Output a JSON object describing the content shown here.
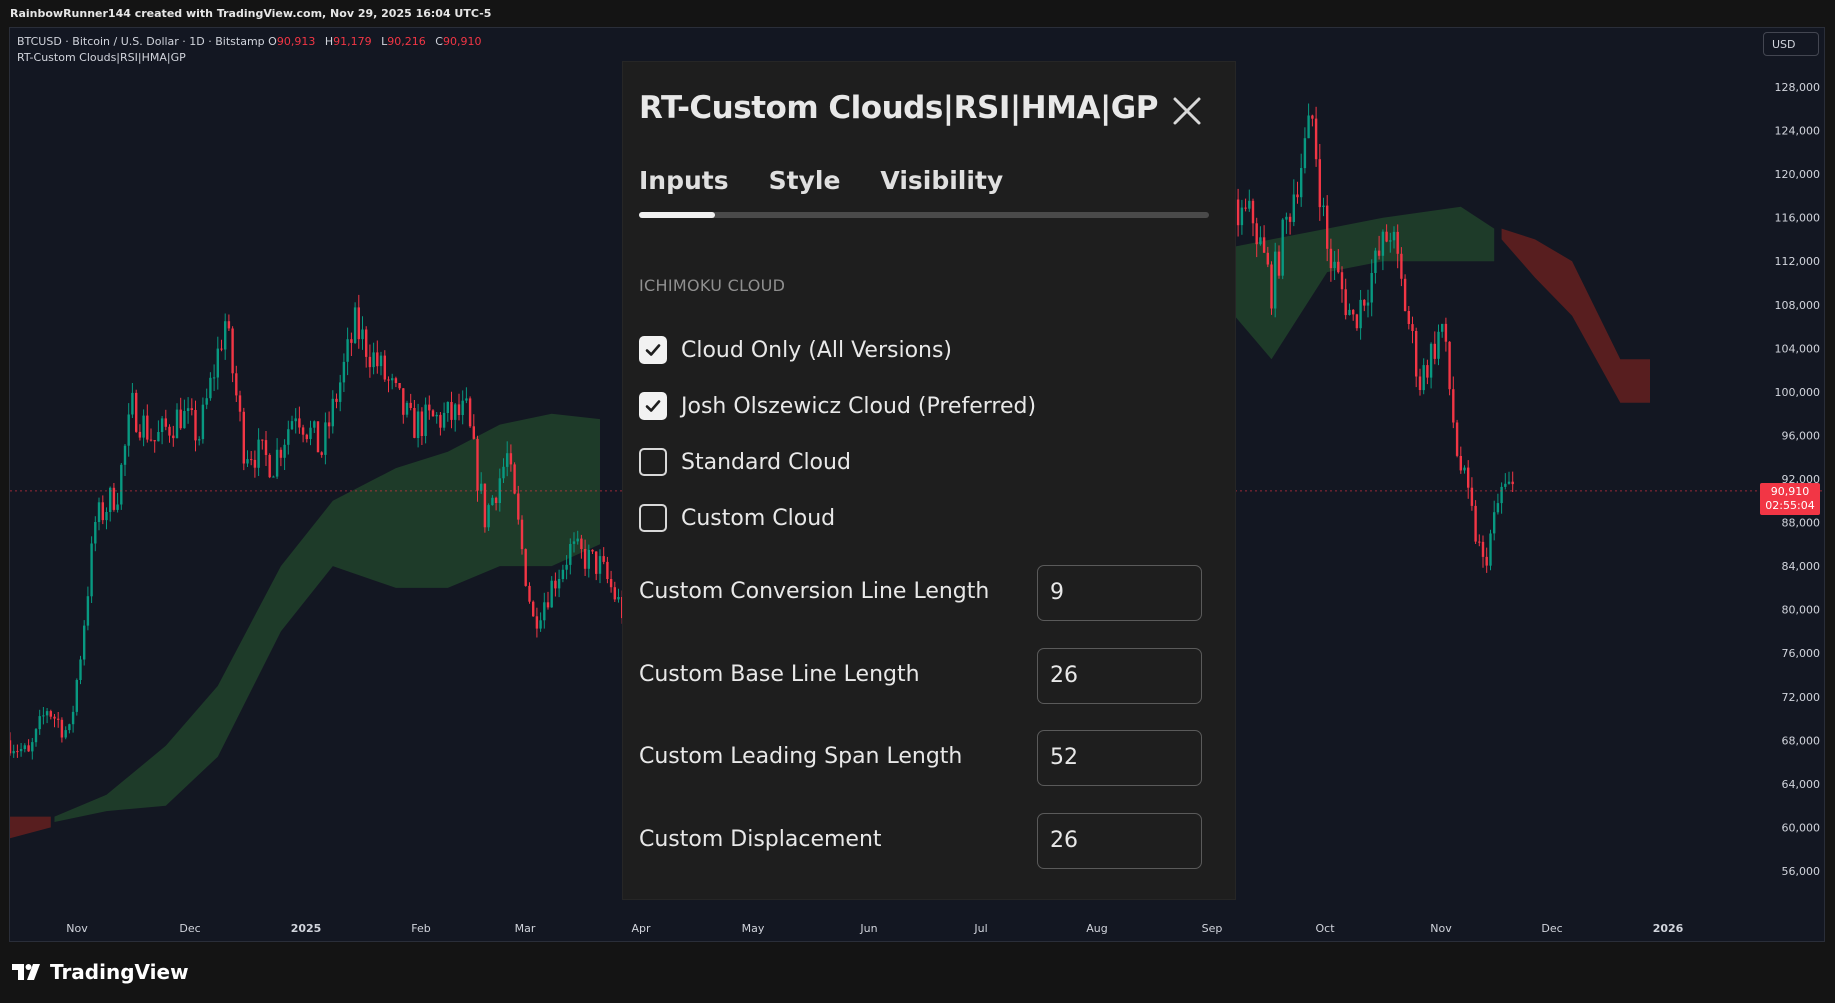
{
  "header": {
    "credit": "RainbowRunner144 created with TradingView.com, Nov 29, 2025 16:04 UTC-5"
  },
  "chart": {
    "symbol": "BTCUSD · Bitcoin / U.S. Dollar · 1D · Bitstamp",
    "open_label": "O",
    "open": "90,913",
    "high_label": "H",
    "high": "91,179",
    "low_label": "L",
    "low": "90,216",
    "close_label": "C",
    "close": "90,910",
    "indicator": "RT-Custom Clouds|RSI|HMA|GP",
    "currency": "USD",
    "last_price": "90,910",
    "countdown": "02:55:04"
  },
  "footer": {
    "brand": "TradingView"
  },
  "dialog": {
    "title": "RT-Custom Clouds|RSI|HMA|GP",
    "tabs": [
      "Inputs",
      "Style",
      "Visibility"
    ],
    "active_tab": "Inputs",
    "section": "ICHIMOKU CLOUD",
    "checkboxes": [
      {
        "label": "Cloud Only (All Versions)",
        "checked": true
      },
      {
        "label": "Josh Olszewicz Cloud (Preferred)",
        "checked": true
      },
      {
        "label": "Standard Cloud",
        "checked": false
      },
      {
        "label": "Custom Cloud",
        "checked": false
      }
    ],
    "fields": [
      {
        "label": "Custom Conversion Line Length",
        "value": "9"
      },
      {
        "label": "Custom Base Line Length",
        "value": "26"
      },
      {
        "label": "Custom Leading Span Length",
        "value": "52"
      },
      {
        "label": "Custom Displacement",
        "value": "26"
      }
    ]
  },
  "chart_data": {
    "type": "candlestick",
    "title": "BTCUSD · Bitcoin / U.S. Dollar · 1D · Bitstamp",
    "x_tick_labels": [
      "Nov",
      "Dec",
      "2025",
      "Feb",
      "Mar",
      "Apr",
      "May",
      "Jun",
      "Jul",
      "Aug",
      "Sep",
      "Oct",
      "Nov",
      "Dec",
      "2026"
    ],
    "y_tick_labels": [
      "128,000",
      "124,000",
      "120,000",
      "116,000",
      "112,000",
      "108,000",
      "104,000",
      "100,000",
      "96,000",
      "92,000",
      "88,000",
      "84,000",
      "80,000",
      "76,000",
      "72,000",
      "68,000",
      "64,000",
      "60,000",
      "56,000"
    ],
    "ylim": [
      54000,
      130000
    ],
    "price_path": [
      [
        "2024-10-20",
        68000
      ],
      [
        "2024-10-25",
        66500
      ],
      [
        "2024-10-30",
        71000
      ],
      [
        "2024-11-05",
        68500
      ],
      [
        "2024-11-08",
        76000
      ],
      [
        "2024-11-12",
        88000
      ],
      [
        "2024-11-18",
        91000
      ],
      [
        "2024-11-22",
        98500
      ],
      [
        "2024-11-28",
        95500
      ],
      [
        "2024-12-05",
        98000
      ],
      [
        "2024-12-10",
        96000
      ],
      [
        "2024-12-17",
        106500
      ],
      [
        "2024-12-22",
        95000
      ],
      [
        "2024-12-30",
        93500
      ],
      [
        "2025-01-05",
        98500
      ],
      [
        "2025-01-12",
        94500
      ],
      [
        "2025-01-21",
        106000
      ],
      [
        "2025-01-28",
        102000
      ],
      [
        "2025-02-05",
        97000
      ],
      [
        "2025-02-12",
        97500
      ],
      [
        "2025-02-20",
        98000
      ],
      [
        "2025-02-25",
        88500
      ],
      [
        "2025-03-03",
        94000
      ],
      [
        "2025-03-10",
        79000
      ],
      [
        "2025-03-20",
        85500
      ],
      [
        "2025-03-28",
        84000
      ],
      [
        "2025-04-08",
        76500
      ],
      [
        "2025-04-20",
        85000
      ],
      [
        "2025-05-05",
        95000
      ],
      [
        "2025-05-22",
        111000
      ],
      [
        "2025-06-10",
        109000
      ],
      [
        "2025-06-22",
        100000
      ],
      [
        "2025-07-14",
        120000
      ],
      [
        "2025-08-02",
        113000
      ],
      [
        "2025-08-14",
        123000
      ],
      [
        "2025-08-30",
        108500
      ],
      [
        "2025-09-08",
        112000
      ],
      [
        "2025-09-15",
        116000
      ],
      [
        "2025-09-20",
        116000
      ],
      [
        "2025-09-25",
        109500
      ],
      [
        "2025-10-01",
        118500
      ],
      [
        "2025-10-06",
        125000
      ],
      [
        "2025-10-10",
        113000
      ],
      [
        "2025-10-17",
        106500
      ],
      [
        "2025-10-27",
        115000
      ],
      [
        "2025-11-04",
        101000
      ],
      [
        "2025-11-10",
        106000
      ],
      [
        "2025-11-14",
        94500
      ],
      [
        "2025-11-21",
        84000
      ],
      [
        "2025-11-24",
        88000
      ],
      [
        "2025-11-26",
        91000
      ],
      [
        "2025-11-29",
        90910
      ]
    ],
    "cloud_green": [
      [
        "2024-11-01",
        60500,
        61000
      ],
      [
        "2024-11-15",
        61500,
        63000
      ],
      [
        "2024-12-01",
        62000,
        67500
      ],
      [
        "2024-12-15",
        66500,
        73000
      ],
      [
        "2025-01-01",
        78000,
        84000
      ],
      [
        "2025-01-15",
        84000,
        90000
      ],
      [
        "2025-02-01",
        82000,
        93000
      ],
      [
        "2025-02-15",
        82000,
        94500
      ],
      [
        "2025-03-01",
        84000,
        97000
      ],
      [
        "2025-03-15",
        84000,
        98000
      ],
      [
        "2025-03-28",
        86000,
        97500
      ],
      [
        "2025-09-10",
        109000,
        113000
      ],
      [
        "2025-09-25",
        103000,
        114000
      ],
      [
        "2025-10-10",
        111000,
        115000
      ],
      [
        "2025-10-25",
        112000,
        116000
      ],
      [
        "2025-11-15",
        112000,
        117000
      ],
      [
        "2025-11-24",
        112000,
        115000
      ]
    ],
    "cloud_red": [
      [
        "2024-10-20",
        59000,
        61000
      ],
      [
        "2024-10-31",
        60000,
        61000
      ],
      [
        "2025-11-26",
        114000,
        115000
      ],
      [
        "2025-12-05",
        110500,
        114000
      ],
      [
        "2025-12-15",
        107000,
        112000
      ],
      [
        "2025-12-28",
        99000,
        103000
      ],
      [
        "2026-01-05",
        99000,
        103000
      ]
    ],
    "colors": {
      "up": "#089981",
      "down": "#f23645",
      "cloud_green": "#1f3d2a",
      "cloud_red": "#5c1f20",
      "background": "#131722"
    }
  }
}
